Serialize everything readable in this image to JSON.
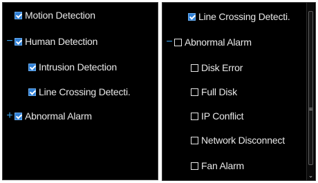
{
  "left_tree": [
    {
      "label": "Motion Detection",
      "checked": true,
      "toggle": ""
    },
    {
      "label": "Human Detection",
      "checked": true,
      "toggle": "−"
    },
    {
      "label": "Intrusion Detection",
      "checked": true,
      "toggle": ""
    },
    {
      "label": "Line Crossing Detecti.",
      "checked": true,
      "toggle": ""
    },
    {
      "label": "Abnormal Alarm",
      "checked": true,
      "toggle": "+"
    }
  ],
  "right_tree": [
    {
      "label": "Line Crossing Detecti.",
      "checked": true,
      "toggle": ""
    },
    {
      "label": "Abnormal Alarm",
      "checked": false,
      "toggle": "−"
    },
    {
      "label": "Disk Error",
      "checked": false,
      "toggle": ""
    },
    {
      "label": "Full Disk",
      "checked": false,
      "toggle": ""
    },
    {
      "label": "IP Conflict",
      "checked": false,
      "toggle": ""
    },
    {
      "label": "Network Disconnect",
      "checked": false,
      "toggle": ""
    },
    {
      "label": "Fan Alarm",
      "checked": false,
      "toggle": ""
    }
  ],
  "scrollbar": {
    "grip_icon": "grip-lines-icon",
    "down_icon": "chevron-down-icon"
  },
  "colors": {
    "panel_bg": "#000000",
    "checkbox_blue": "#2f7fd6",
    "toggle_blue": "#3aa0e8",
    "text": "#e8e8e8"
  }
}
